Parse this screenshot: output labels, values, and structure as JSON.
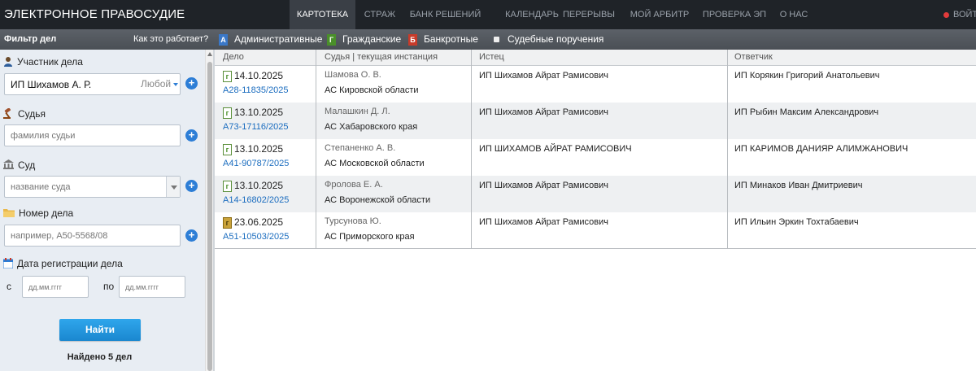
{
  "brand": "ЭЛЕКТРОННОЕ ПРАВОСУДИЕ",
  "nav": [
    {
      "label": "КАРТОТЕКА"
    },
    {
      "label": "СТРАЖ"
    },
    {
      "label": "БАНК РЕШЕНИЙ"
    },
    {
      "label": "КАЛЕНДАРЬ"
    },
    {
      "label": "ПЕРЕРЫВЫ"
    },
    {
      "label": "МОЙ АРБИТР"
    },
    {
      "label": "ПРОВЕРКА ЭП"
    },
    {
      "label": "О НАС"
    }
  ],
  "top_right": "ВОЙТИ",
  "filter": {
    "title": "Фильтр дел",
    "how": "Как это работает?",
    "categories": [
      {
        "badge": "А",
        "label": "Административные"
      },
      {
        "badge": "Г",
        "label": "Гражданские"
      },
      {
        "badge": "Б",
        "label": "Банкротные"
      },
      {
        "badge": "",
        "label": "Судебные поручения"
      }
    ]
  },
  "sidebar": {
    "participant_label": "Участник дела",
    "participant_value": "ИП Шихамов А. Р.",
    "participant_mode": "Любой",
    "judge_label": "Судья",
    "judge_placeholder": "фамилия судьи",
    "court_label": "Суд",
    "court_placeholder": "название суда",
    "case_label": "Номер дела",
    "case_placeholder": "например, А50-5568/08",
    "date_label": "Дата регистрации дела",
    "date_from_label": "с",
    "date_to_label": "по",
    "date_placeholder": "дд.мм.гггг",
    "find_button": "Найти",
    "found_text": "Найдено 5 дел"
  },
  "table": {
    "headers": [
      "Дело",
      "Судья | текущая инстанция",
      "Истец",
      "Ответчик"
    ],
    "rows": [
      {
        "icon": "г",
        "date": "14.10.2025",
        "number": "А28-11835/2025",
        "judge": "Шамова О. В.",
        "court": "АС Кировской области",
        "plaintiff": "ИП Шихамов Айрат Рамисович",
        "defendant": "ИП Корякин Григорий Анатольевич"
      },
      {
        "icon": "г",
        "date": "13.10.2025",
        "number": "А73-17116/2025",
        "judge": "Малашкин Д. Л.",
        "court": "АС Хабаровского края",
        "plaintiff": "ИП Шихамов Айрат Рамисович",
        "defendant": "ИП Рыбин Максим Александрович"
      },
      {
        "icon": "г",
        "date": "13.10.2025",
        "number": "А41-90787/2025",
        "judge": "Степаненко А. В.",
        "court": "АС Московской области",
        "plaintiff": "ИП ШИХАМОВ АЙРАТ РАМИСОВИЧ",
        "defendant": "ИП КАРИМОВ ДАНИЯР АЛИМЖАНОВИЧ"
      },
      {
        "icon": "г",
        "date": "13.10.2025",
        "number": "А14-16802/2025",
        "judge": "Фролова Е. А.",
        "court": "АС Воронежской области",
        "plaintiff": "ИП Шихамов Айрат Рамисович",
        "defendant": "ИП Минаков Иван Дмитриевич"
      },
      {
        "icon": "г",
        "date": "23.06.2025",
        "number": "А51-10503/2025",
        "judge": "Турсунова Ю.",
        "court": "АС Приморского края",
        "plaintiff": "ИП Шихамов Айрат Рамисович",
        "defendant": "ИП Ильин Эркин Тохтабаевич"
      }
    ]
  },
  "colors": {
    "topbar": "#1f2328",
    "accent": "#2d7ed6",
    "link": "#1a6cbf",
    "sidebar": "#e8edf3"
  }
}
